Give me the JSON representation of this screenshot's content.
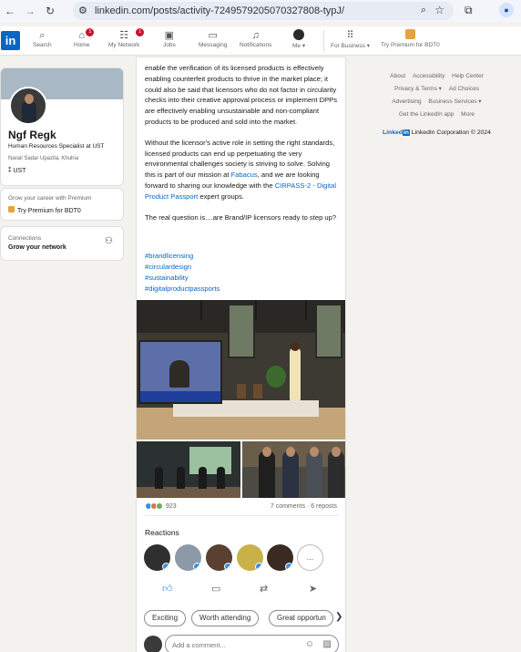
{
  "browser": {
    "url": "linkedin.com/posts/activity-7249579205070327808-typJ/"
  },
  "header": {
    "logo": "in",
    "nav": [
      {
        "label": "Search",
        "icon": "search-icon"
      },
      {
        "label": "Home",
        "icon": "home-icon",
        "badge": "1"
      },
      {
        "label": "My Network",
        "icon": "network-icon",
        "badge": "1"
      },
      {
        "label": "Jobs",
        "icon": "briefcase-icon"
      },
      {
        "label": "Messaging",
        "icon": "message-icon"
      },
      {
        "label": "Notifications",
        "icon": "bell-icon"
      },
      {
        "label": "Me ▾",
        "icon": "avatar"
      },
      {
        "label": "For Business ▾",
        "icon": "grid-icon"
      },
      {
        "label": "Try Premium for BDT0",
        "icon": "premium-icon"
      }
    ]
  },
  "profile": {
    "name": "Ngf Regk",
    "headline": "Human Resources Specialist at UST",
    "location": "Narail Sadar Upazila, Khulna",
    "company": "UST"
  },
  "premium_card": {
    "subtitle": "Grow your career with Premium",
    "link": "Try Premium for BDT0"
  },
  "connections": {
    "title": "Connections",
    "subtitle": "Grow your network"
  },
  "post": {
    "para1": "enable the verification of its licensed products is effectively enabling counterfeit products to thrive in the market place; it could also be said that licensors who do not factor in circularity checks into their creative approval process or implement DPPs are effectively enabling unsustainable and non-compliant products to be produced and sold into the market.",
    "para2_a": "Without the licensor's active role in setting the right standards, licensed products can end up perpetuating the very environmental challenges society is striving to solve. Solving this is part of our mission at ",
    "para2_link1": "Fabacus",
    "para2_b": ", and we are looking forward to sharing our knowledge with the ",
    "para2_link2": "CIRPASS-2 - Digital Product Passport",
    "para2_c": " expert groups.",
    "para3": "The real question is....are Brand/IP licensors ready to step up?",
    "hashtags": [
      "#brandlicensing",
      "#circulardesign",
      "#sustainability",
      "#digitalproductpassports"
    ],
    "reaction_count": "923",
    "comments_reposts": "7 comments · 6 reposts",
    "reactions_title": "Reactions",
    "more_reactors": "...",
    "chips": [
      "Exciting",
      "Worth attending",
      "Great opportun"
    ],
    "chip_next": "❯",
    "comment_placeholder": "Add a comment..."
  },
  "footer": {
    "row1": [
      "About",
      "Accessibility",
      "Help Center"
    ],
    "row2": [
      "Privacy & Terms ▾",
      "Ad Choices"
    ],
    "row3": [
      "Advertising",
      "Business Services ▾"
    ],
    "row4": [
      "Get the LinkedIn app",
      "More"
    ],
    "brand_word": "Linked",
    "brand_in": "in",
    "copyright": "LinkedIn Corporation © 2024"
  },
  "colors": {
    "accent": "#0a66c2",
    "badge": "#cb112d",
    "premium": "#e7a33e",
    "page_bg": "#f4f2ee"
  }
}
